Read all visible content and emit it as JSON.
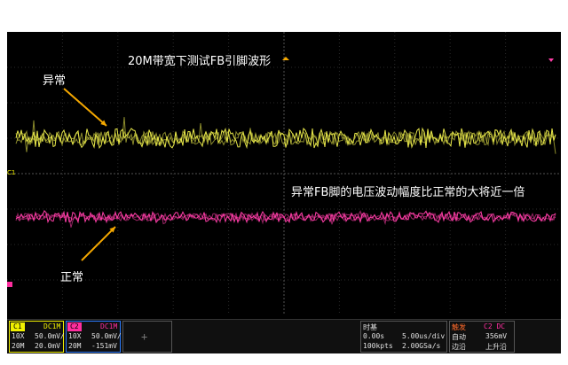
{
  "annotations": {
    "title": "20M带宽下测试FB引脚波形",
    "abnormal_label": "异常",
    "normal_label": "正常",
    "note": "异常FB脚的电压波动幅度比正常的大将近一倍"
  },
  "markers": {
    "c1": "C1"
  },
  "channels": [
    {
      "name": "C1",
      "coupling": "DC1M",
      "probe": "10X",
      "scale": "50.0mV/",
      "bw": "20M",
      "offset": "20.0mV",
      "color": "#f0f000"
    },
    {
      "name": "C2",
      "coupling": "DC1M",
      "probe": "10X",
      "scale": "50.0mV/",
      "bw": "20M",
      "offset": "-151mV",
      "color": "#ff2ea0"
    }
  ],
  "timebase": {
    "label": "时基",
    "delay": "0.00s",
    "scale": "5.00us/div",
    "points": "100kpts",
    "rate": "2.00GSa/s"
  },
  "trigger": {
    "label": "触发",
    "source": "C2 DC",
    "mode": "自动",
    "level": "356mV",
    "type": "边沿",
    "slope": "上升沿"
  },
  "colors": {
    "abnormal_trace": "#e8e84a",
    "normal_trace": "#ff3ea8",
    "arrow": "#f5a800",
    "background": "#000000"
  }
}
